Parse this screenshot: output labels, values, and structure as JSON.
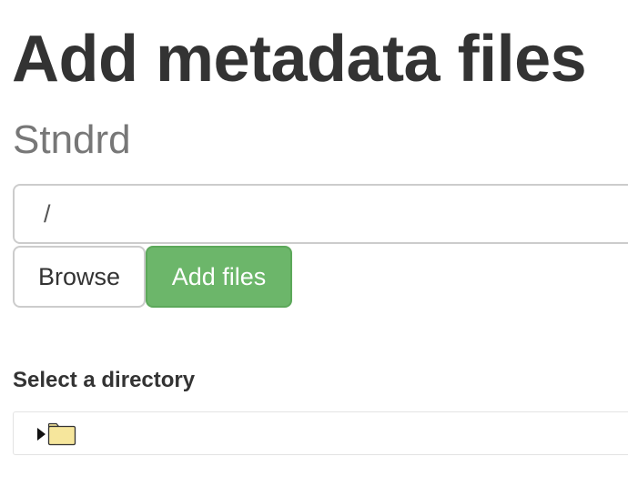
{
  "page": {
    "title": "Add metadata files",
    "subtitle": "Stndrd"
  },
  "path_field": {
    "value": "/"
  },
  "buttons": {
    "browse_label": "Browse",
    "add_files_label": "Add files"
  },
  "directory_picker": {
    "label": "Select a directory",
    "root_node": {
      "expanded": false,
      "expander_icon": "caret-right-icon",
      "icon": "folder-icon"
    }
  },
  "colors": {
    "add_files_button": "#6cb66a",
    "folder": "#f6e69c"
  }
}
